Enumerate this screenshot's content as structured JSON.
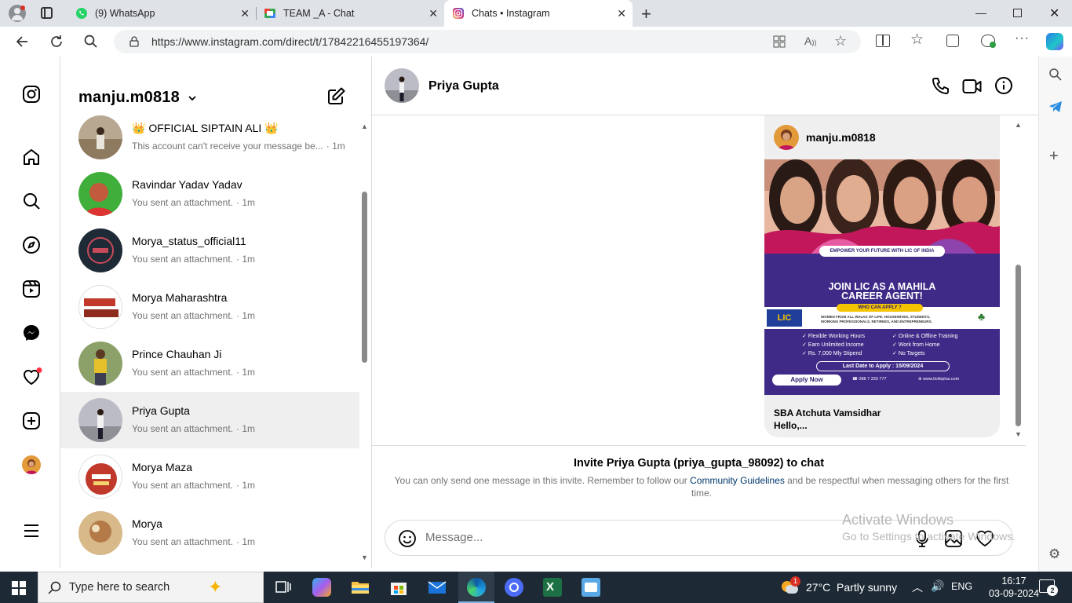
{
  "browser": {
    "tabs": [
      {
        "title": "(9) WhatsApp",
        "icon": "whatsapp-icon"
      },
      {
        "title": "TEAM _A - Chat",
        "icon": "chat-icon"
      },
      {
        "title": "Chats • Instagram",
        "icon": "instagram-icon",
        "active": true
      }
    ],
    "new_tab": "+",
    "url": "https://www.instagram.com/direct/t/17842216455197364/"
  },
  "instagram": {
    "username": "manju.m0818",
    "conversations": [
      {
        "name": "👑 OFFICIAL SIPTAIN ALI 👑",
        "preview": "This account can't receive your message be...",
        "time": "· 1m"
      },
      {
        "name": "Ravindar Yadav Yadav",
        "preview": "You sent an attachment.",
        "time": "· 1m"
      },
      {
        "name": "Morya_status_official11",
        "preview": "You sent an attachment.",
        "time": "· 1m"
      },
      {
        "name": "Morya Maharashtra",
        "preview": "You sent an attachment.",
        "time": "· 1m"
      },
      {
        "name": "Prince Chauhan Ji",
        "preview": "You sent an attachment.",
        "time": "· 1m"
      },
      {
        "name": "Priya Gupta",
        "preview": "You sent an attachment.",
        "time": "· 1m",
        "selected": true
      },
      {
        "name": "Morya Maza",
        "preview": "You sent an attachment.",
        "time": "· 1m"
      },
      {
        "name": "Morya",
        "preview": "You sent an attachment.",
        "time": "· 1m"
      }
    ],
    "chat": {
      "name": "Priya Gupta",
      "shared_post": {
        "author": "manju.m0818",
        "poster": {
          "banner": "EMPOWER YOUR FUTURE WITH LIC OF INDIA",
          "headline_1": "JOIN LIC AS A MAHILA",
          "headline_2": "CAREER AGENT!",
          "question": "WHO CAN APPLY ?",
          "who_1": "WOMEN FROM ALL WALKS OF LIFE: HOUSEWIVES, STUDENTS,",
          "who_2": "WORKING PROFESSIONALS, RETIREES, AND ENTREPRENEURS.",
          "logo": "LIC",
          "benefits": [
            "Flexible Working Hours",
            "Online & Offline Training",
            "Earn Unlimited Income",
            "Work from Home",
            "Rs. 7,000 Mly Stipend",
            "No Targets"
          ],
          "deadline": "Last Date to Apply : 15/09/2024",
          "apply": "Apply Now",
          "phone": "088 7 333 777",
          "web": "www.licifeplus.com"
        },
        "caption_1": "SBA Atchuta Vamsidhar",
        "caption_2": "Hello,..."
      },
      "invite_title": "Invite Priya Gupta (priya_gupta_98092) to chat",
      "invite_text_1": "You can only send one message in this invite. Remember to follow our",
      "invite_link": "Community Guidelines",
      "invite_text_2": "and be respectful when messaging others for the first time.",
      "message_placeholder": "Message..."
    }
  },
  "watermark": {
    "title": "Activate Windows",
    "subtitle": "Go to Settings to activate Windows."
  },
  "taskbar": {
    "search_placeholder": "Type here to search",
    "weather": "27°C  Partly sunny",
    "weather_badge": "1",
    "language": "ENG",
    "time": "16:17",
    "date": "03-09-2024",
    "notification_count": "2"
  }
}
